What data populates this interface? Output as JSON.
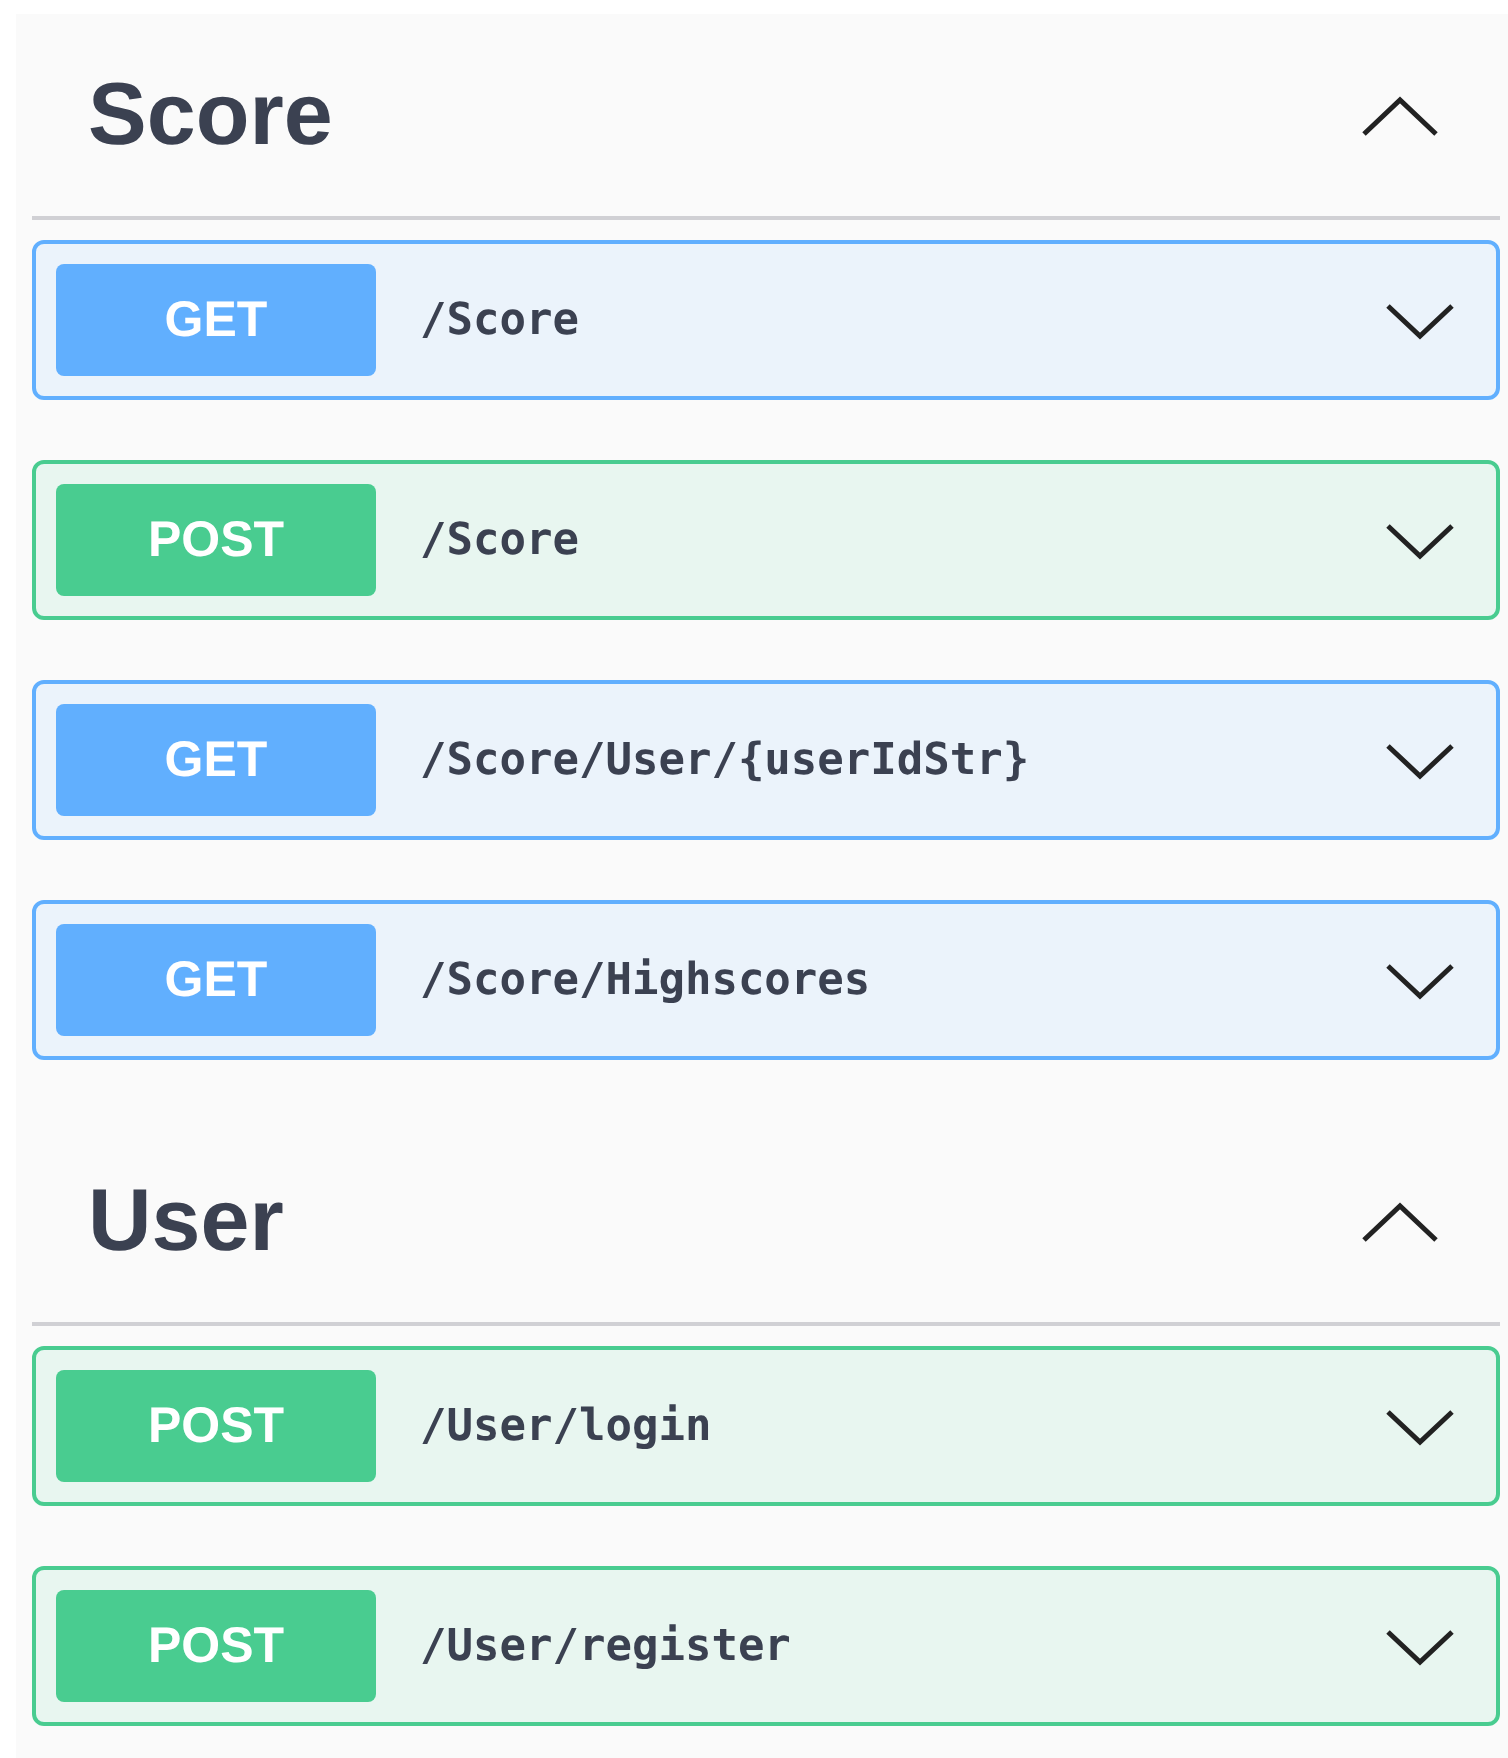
{
  "sections": [
    {
      "title": "Score",
      "expanded": true,
      "operations": [
        {
          "kind": "get",
          "method": "GET",
          "path": "/Score",
          "expanded": false
        },
        {
          "kind": "post",
          "method": "POST",
          "path": "/Score",
          "expanded": false
        },
        {
          "kind": "get",
          "method": "GET",
          "path": "/Score/User/{userIdStr}",
          "expanded": false
        },
        {
          "kind": "get",
          "method": "GET",
          "path": "/Score/Highscores",
          "expanded": false
        }
      ]
    },
    {
      "title": "User",
      "expanded": true,
      "operations": [
        {
          "kind": "post",
          "method": "POST",
          "path": "/User/login",
          "expanded": false
        },
        {
          "kind": "post",
          "method": "POST",
          "path": "/User/register",
          "expanded": false
        }
      ]
    }
  ]
}
